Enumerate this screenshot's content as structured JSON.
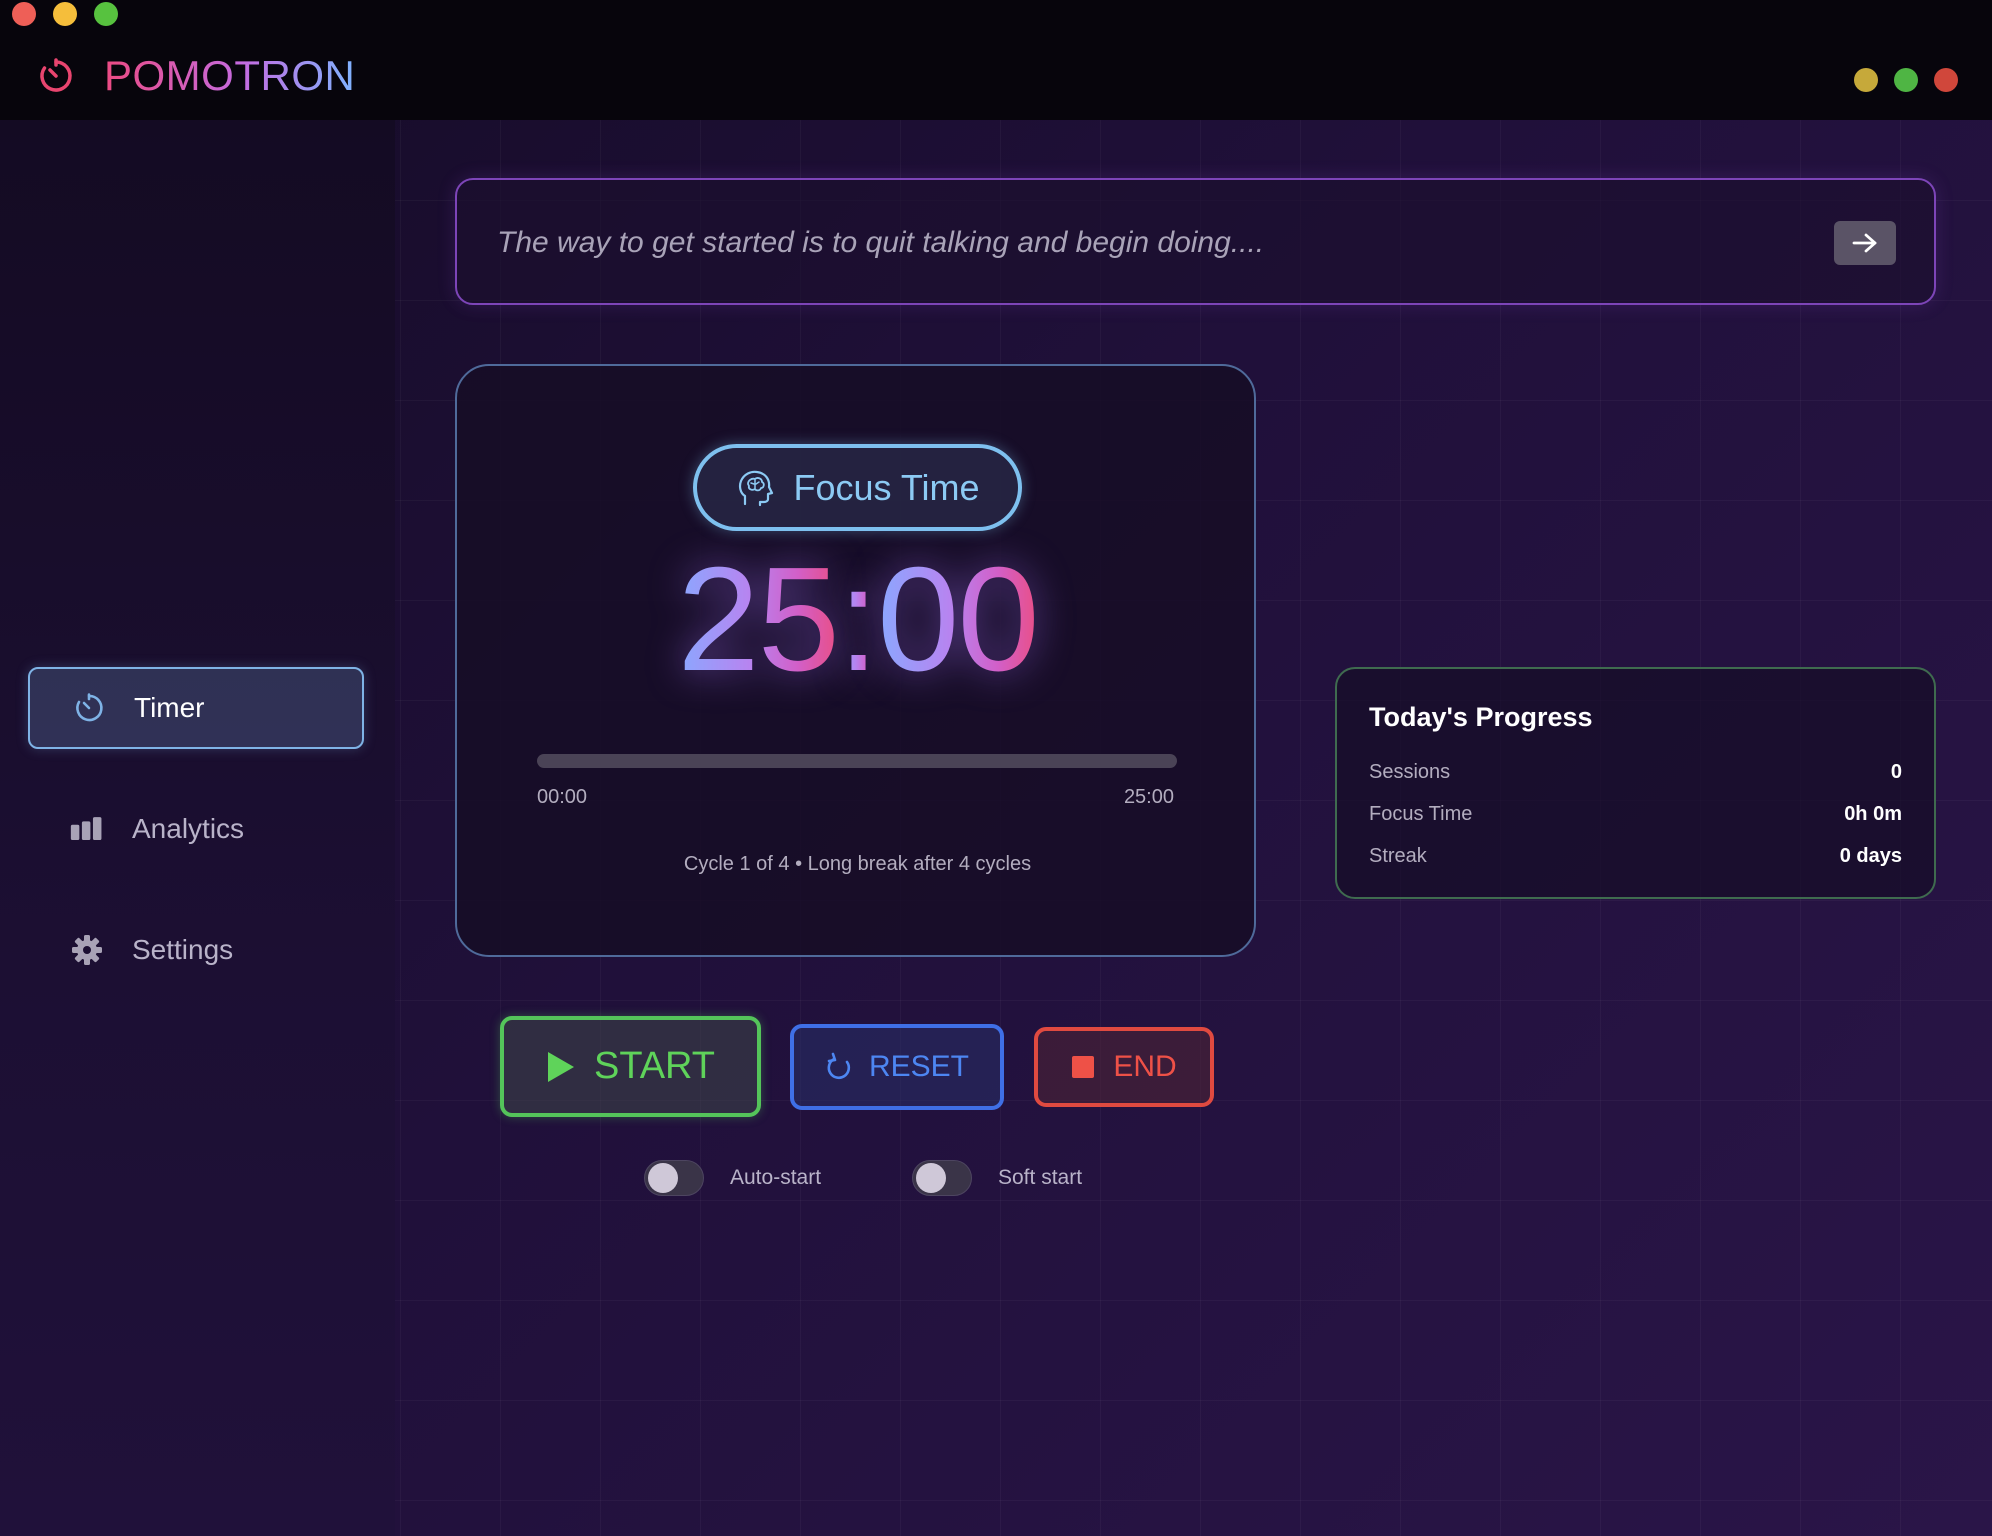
{
  "app": {
    "title": "POMOTRON"
  },
  "sidebar": {
    "items": [
      {
        "label": "Timer",
        "icon": "timer-icon",
        "active": true
      },
      {
        "label": "Analytics",
        "icon": "bar-chart-icon",
        "active": false
      },
      {
        "label": "Settings",
        "icon": "gear-icon",
        "active": false
      }
    ]
  },
  "quote": {
    "text": "The way to get started is to quit talking and begin doing....",
    "button_icon": "arrow-right-icon"
  },
  "timer": {
    "mode_label": "Focus Time",
    "mode_icon": "brain-head-icon",
    "minutes": "25",
    "separator": ":",
    "seconds": "00",
    "progress_fraction": 0,
    "progress_start": "00:00",
    "progress_end": "25:00",
    "cycle_info": "Cycle 1 of 4 • Long break after 4 cycles"
  },
  "todays_progress": {
    "title": "Today's Progress",
    "rows": [
      {
        "label": "Sessions",
        "value": "0"
      },
      {
        "label": "Focus Time",
        "value": "0h 0m"
      },
      {
        "label": "Streak",
        "value": "0 days"
      }
    ]
  },
  "controls": {
    "start_label": "START",
    "reset_label": "RESET",
    "end_label": "END"
  },
  "toggles": {
    "auto_start": {
      "label": "Auto-start",
      "on": false
    },
    "soft_start": {
      "label": "Soft start",
      "on": false
    }
  },
  "colors": {
    "accent_pink": "#ec4b83",
    "accent_blue": "#7ec0ef",
    "start_green": "#54c45a",
    "reset_blue": "#3f6fe6",
    "end_red": "#e04a40"
  }
}
